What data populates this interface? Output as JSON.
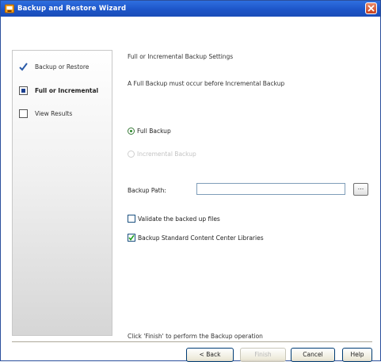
{
  "window": {
    "title": "Backup and Restore Wizard"
  },
  "steps": [
    {
      "label": "Backup or Restore",
      "state": "done",
      "icon": "checkmark-icon"
    },
    {
      "label": "Full or Incremental",
      "state": "current",
      "icon": "current-step-icon"
    },
    {
      "label": "View Results",
      "state": "pending",
      "icon": "empty-step-icon"
    }
  ],
  "main": {
    "heading": "Full or Incremental Backup Settings",
    "note": "A Full Backup must occur before Incremental Backup",
    "options": {
      "full": {
        "label": "Full Backup",
        "checked": true
      },
      "incremental": {
        "label": "Incremental Backup",
        "checked": false,
        "disabled": true
      }
    },
    "path": {
      "label": "Backup Path:",
      "value": "",
      "browse_label": "..."
    },
    "validate": {
      "label": "Validate the backed up files",
      "checked": false
    },
    "standard": {
      "label": "Backup Standard Content Center Libraries",
      "checked": true
    },
    "footer": "Click 'Finish' to perform the Backup operation"
  },
  "buttons": {
    "back": "< Back",
    "finish": "Finish",
    "cancel": "Cancel",
    "help": "Help"
  },
  "colors": {
    "titlebar": "#1d55c8",
    "accent_check": "#2d8a2d"
  }
}
